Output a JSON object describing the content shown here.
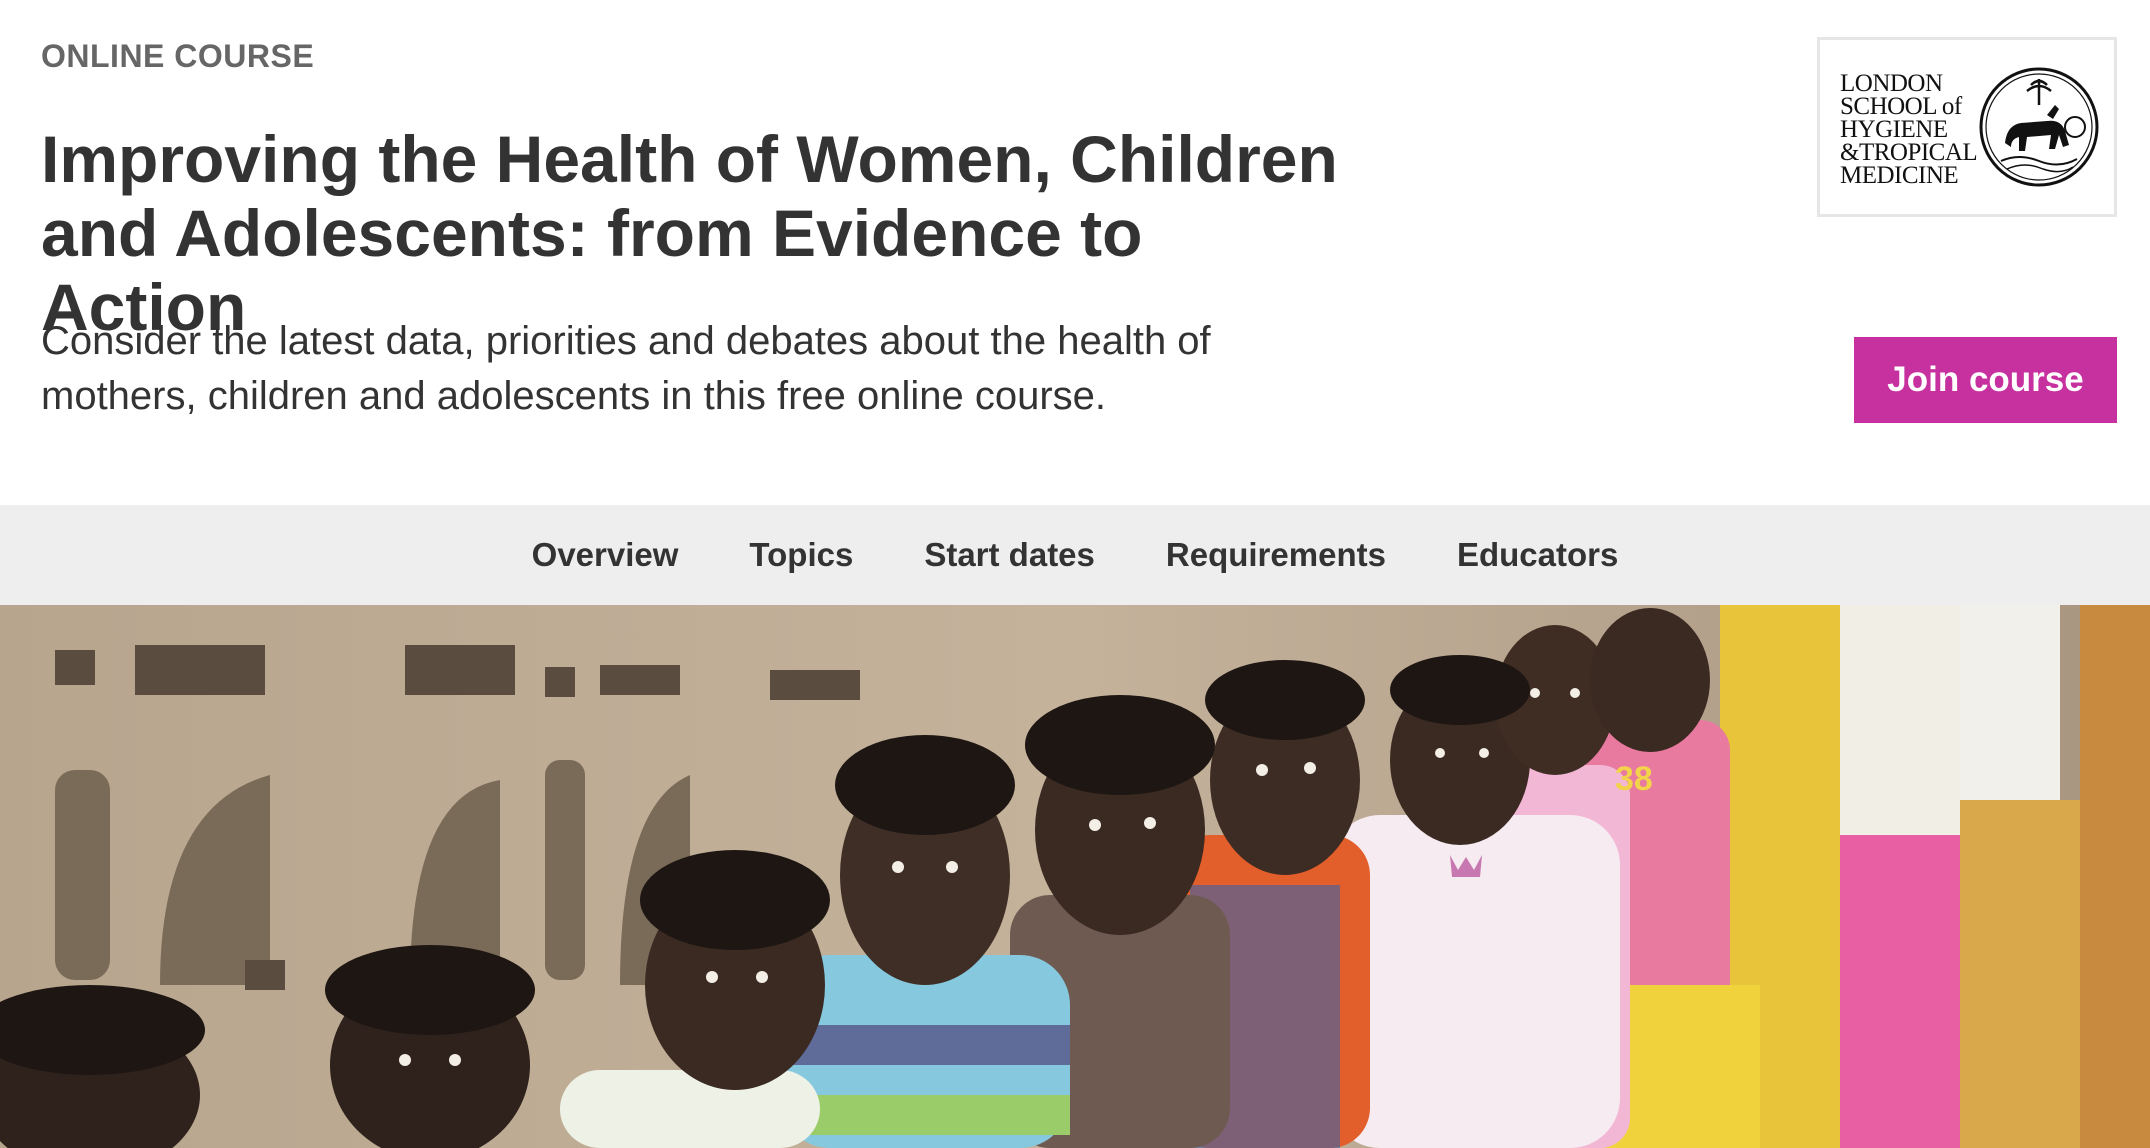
{
  "header": {
    "eyebrow": "ONLINE COURSE",
    "title": "Improving the Health of Women, Children and Adolescents: from Evidence to Action",
    "subtitle": "Consider the latest data, priorities and debates about the health of mothers, children and adolescents in this free online course.",
    "join_label": "Join course"
  },
  "logo": {
    "lines": [
      "LONDON",
      "SCHOOL of",
      "HYGIENE",
      "&TROPICAL",
      "MEDICINE"
    ]
  },
  "nav": {
    "items": [
      {
        "label": "Overview"
      },
      {
        "label": "Topics"
      },
      {
        "label": "Start dates"
      },
      {
        "label": "Requirements"
      },
      {
        "label": "Educators"
      }
    ]
  },
  "colors": {
    "accent": "#c7319f",
    "nav_bg": "#eeeeee",
    "text": "#333333"
  },
  "icons": {
    "logo_seal": "crest-seal-icon"
  }
}
